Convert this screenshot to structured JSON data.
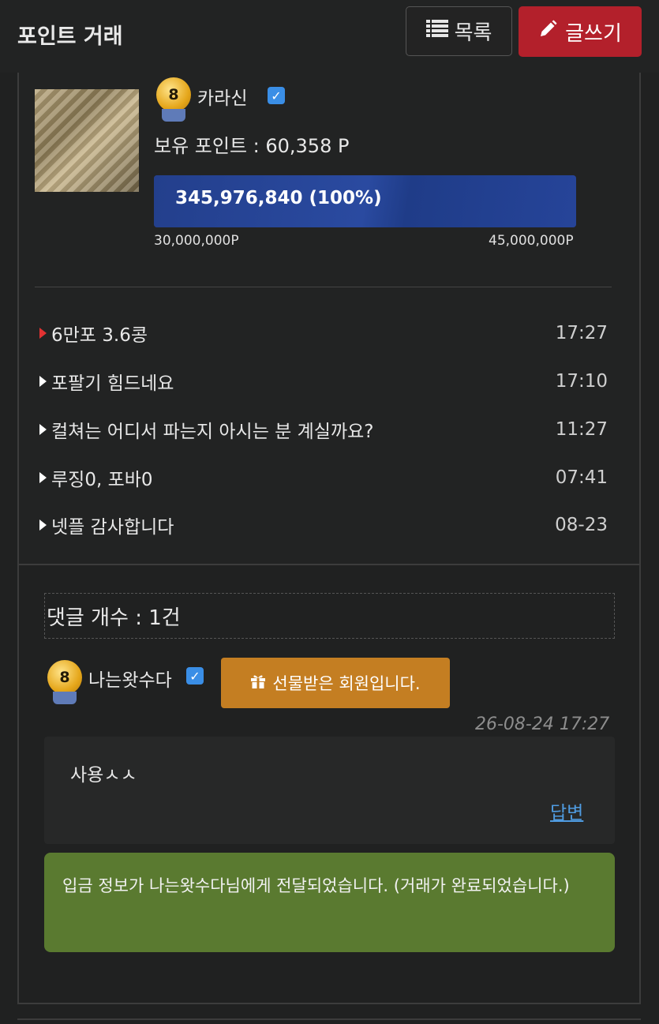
{
  "header": {
    "title": "포인트 거래",
    "list_button": "목록",
    "write_button": "글쓰기"
  },
  "author": {
    "level": "8",
    "name": "카라신",
    "verified": true,
    "points_label": "보유 포인트 : 60,358 P"
  },
  "progress": {
    "label": "345,976,840 (100%)",
    "fraction": 1.0,
    "min_label": "30,000,000P",
    "max_label": "45,000,000P"
  },
  "posts": [
    {
      "title": "6만포 3.6콩",
      "time": "17:27",
      "current": true
    },
    {
      "title": "포팔기 힘드네요",
      "time": "17:10",
      "current": false
    },
    {
      "title": "컬쳐는 어디서 파는지 아시는 분 계실까요?",
      "time": "11:27",
      "current": false
    },
    {
      "title": "루징0, 포바0",
      "time": "07:41",
      "current": false
    },
    {
      "title": "넷플 감사합니다",
      "time": "08-23",
      "current": false
    }
  ],
  "comments": {
    "count_label": "댓글 개수 : 1건",
    "items": [
      {
        "level": "8",
        "author": "나는왓수다",
        "verified": true,
        "badge": "선물받은 회원입니다.",
        "date": "26-08-24 17:27",
        "text": "사용ㅅㅅ",
        "reply_label": "답변"
      }
    ]
  },
  "notice": {
    "text": "입금 정보가 나는왓수다님에게 전달되었습니다. (거래가 완료되었습니다.)"
  },
  "colors": {
    "background": "#202121",
    "write_button": "#b3202b",
    "progress_fill": "#233f8c",
    "gift_badge": "#c47e22",
    "notice_bg": "#5a7a30",
    "link": "#4f9be0",
    "current_arrow": "#e23232"
  },
  "icons": {
    "list": "list-icon",
    "write": "pencil-icon",
    "gift": "gift-icon",
    "verified": "checkbox-checked-icon",
    "level": "level-medal-icon"
  }
}
